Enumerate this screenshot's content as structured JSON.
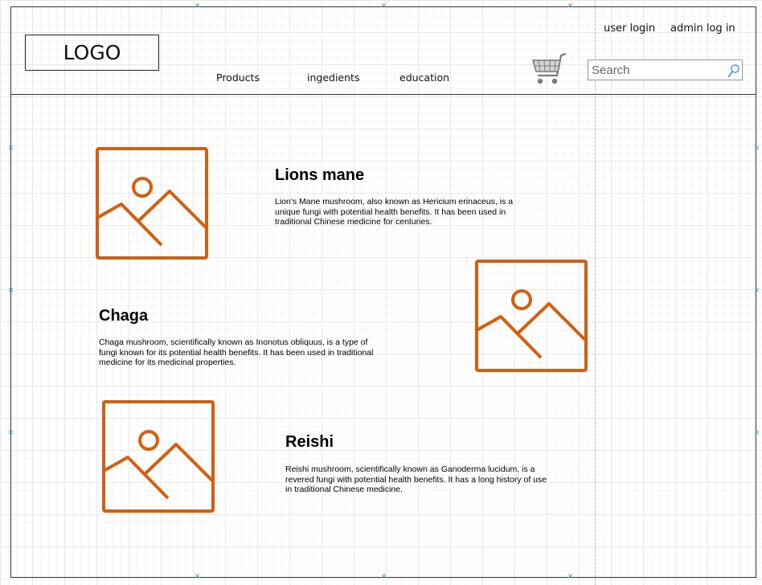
{
  "header": {
    "logo_label": "LOGO",
    "nav": [
      {
        "label": "Products"
      },
      {
        "label": "ingedients"
      },
      {
        "label": "education"
      }
    ],
    "user_login_label": "user login",
    "admin_login_label": "admin log in",
    "search": {
      "placeholder": "Search",
      "value": ""
    },
    "cart_icon": "shopping-cart-icon",
    "search_icon": "magnifier-icon"
  },
  "items": [
    {
      "title": "Lions mane",
      "description": "Lion's Mane mushroom, also known as Hericium erinaceus, is a unique fungi with potential health benefits. It has been used in traditional Chinese medicine for centuries.",
      "image_icon": "image-placeholder-icon"
    },
    {
      "title": "Chaga",
      "description": "Chaga mushroom, scientifically known as Inonotus obliquus, is a type of fungi known for its potential health benefits. It has been used in traditional medicine for its medicinal properties.",
      "image_icon": "image-placeholder-icon"
    },
    {
      "title": "Reishi",
      "description": "Reishi mushroom, scientifically known as Ganoderma lucidum, is a revered fungi with potential health benefits. It has a long history of use in traditional Chinese medicine.",
      "image_icon": "image-placeholder-icon"
    }
  ],
  "colors": {
    "placeholder_accent": "#d35f0f",
    "marker": "#3a9ad9",
    "search_icon": "#3a9ad9"
  }
}
